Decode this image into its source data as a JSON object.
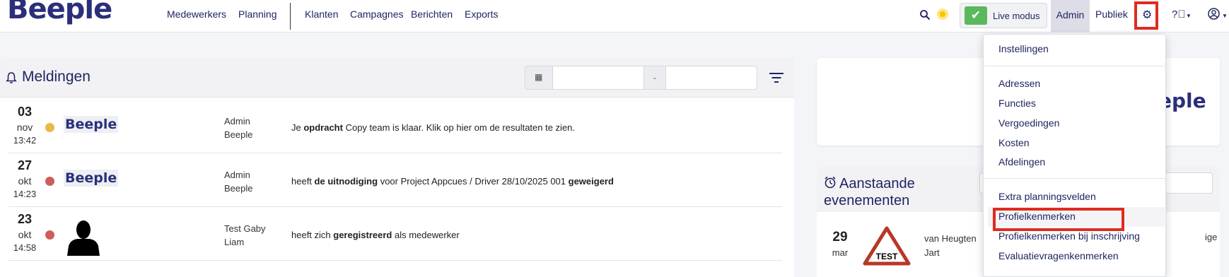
{
  "brand": {
    "logo_text": "Beeple",
    "primary": "#2b2f7a",
    "accent_green": "#5cb85c",
    "highlight_red": "#e02b1f"
  },
  "nav": {
    "main_links": [
      "Medewerkers",
      "Planning"
    ],
    "secondary_links": [
      "Klanten",
      "Campagnes",
      "Berichten",
      "Exports"
    ],
    "live_mode_label": "Live modus",
    "admin_label": "Admin",
    "publiek_label": "Publiek",
    "icons": [
      "search-icon",
      "sun-icon",
      "check-icon",
      "gear-icon",
      "help-icon",
      "user-icon"
    ]
  },
  "notifications": {
    "title": "Meldingen",
    "date_range_separator": "-",
    "items": [
      {
        "day": "03",
        "month": "nov",
        "time": "13:42",
        "status_color": "#e8b84b",
        "sender_line1": "Admin",
        "sender_line2": "Beeple",
        "avatar": "beeple-logo",
        "message": {
          "pre": "Je ",
          "bold1": "opdracht",
          "mid": " Copy team is klaar. Klik op hier om de resultaten te zien.",
          "bold2": "",
          "post": ""
        }
      },
      {
        "day": "27",
        "month": "okt",
        "time": "14:23",
        "status_color": "#cf5c5c",
        "sender_line1": "Admin",
        "sender_line2": "Beeple",
        "avatar": "beeple-logo",
        "message": {
          "pre": "heeft ",
          "bold1": "de uitnodiging",
          "mid": " voor Project Appcues / Driver 28/10/2025 001 ",
          "bold2": "geweigerd",
          "post": ""
        }
      },
      {
        "day": "23",
        "month": "okt",
        "time": "14:58",
        "status_color": "#cf5c5c",
        "sender_line1": "Test Gaby",
        "sender_line2": "Liam",
        "avatar": "person-silhouette",
        "message": {
          "pre": "heeft zich ",
          "bold1": "geregistreerd",
          "mid": " als medewerker",
          "bold2": "",
          "post": ""
        }
      }
    ]
  },
  "side_panel": {
    "brand_partial": "eple",
    "events_title": "Aanstaande evenementen",
    "event": {
      "day": "29",
      "month": "mar",
      "sign_text": "TEST",
      "sender_line1": "van Heugten",
      "sender_line2": "Jart",
      "extra": "ige"
    }
  },
  "settings_menu": {
    "group1": [
      "Instellingen"
    ],
    "group2": [
      "Adressen",
      "Functies",
      "Vergoedingen",
      "Kosten",
      "Afdelingen"
    ],
    "group3": [
      "Extra planningsvelden",
      "Profielkenmerken",
      "Profielkenmerken bij inschrijving",
      "Evaluatievragenkenmerken"
    ],
    "highlighted_item": "Profielkenmerken"
  }
}
